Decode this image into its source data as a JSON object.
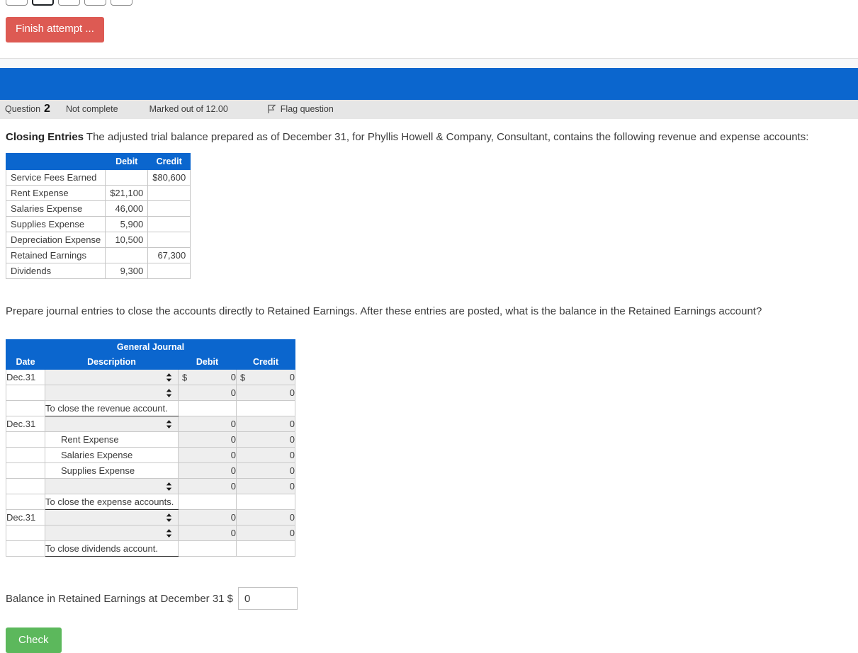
{
  "quiz_nav": {
    "boxes": [
      {
        "label": "",
        "current": false
      },
      {
        "label": "",
        "current": true
      },
      {
        "label": "",
        "current": false
      },
      {
        "label": "",
        "current": false
      },
      {
        "label": "",
        "current": false
      }
    ],
    "finish_attempt_label": "Finish attempt ..."
  },
  "colors": {
    "brand_blue": "#0b66ce",
    "danger_red": "#dd5a53",
    "success_green": "#5cb85c",
    "bar_grey": "#e6e6e6"
  },
  "question_header": {
    "question_label": "Question",
    "question_number": "2",
    "state": "Not complete",
    "marks": "Marked out of 12.00",
    "flag_label": "Flag question",
    "flag_icon": "flag-icon"
  },
  "prompt": {
    "bold_lead": "Closing Entries",
    "text": " The adjusted trial balance prepared as of December 31, for Phyllis Howell & Company, Consultant, contains the following revenue and expense accounts:",
    "second_paragraph": "Prepare journal entries to close the accounts directly to Retained Earnings. After these entries are posted, what is the balance in the Retained Earnings account?"
  },
  "trial_balance": {
    "headers": [
      "",
      "Debit",
      "Credit"
    ],
    "rows": [
      {
        "account": "Service Fees Earned",
        "debit": "",
        "credit": "$80,600"
      },
      {
        "account": "Rent Expense",
        "debit": "$21,100",
        "credit": ""
      },
      {
        "account": "Salaries Expense",
        "debit": "46,000",
        "credit": ""
      },
      {
        "account": "Supplies Expense",
        "debit": "5,900",
        "credit": ""
      },
      {
        "account": "Depreciation Expense",
        "debit": "10,500",
        "credit": ""
      },
      {
        "account": "Retained Earnings",
        "debit": "",
        "credit": "67,300"
      },
      {
        "account": "Dividends",
        "debit": "9,300",
        "credit": ""
      }
    ]
  },
  "general_journal": {
    "title": "General Journal",
    "headers": [
      "Date",
      "Description",
      "Debit",
      "Credit"
    ],
    "rows": [
      {
        "date": "Dec.31",
        "desc": "",
        "desc_type": "select",
        "debit": "0",
        "credit": "0",
        "debit_dollar": "$",
        "credit_dollar": "$",
        "amounts": "input"
      },
      {
        "date": "",
        "desc": "",
        "desc_type": "select",
        "debit": "0",
        "credit": "0",
        "debit_dollar": "",
        "credit_dollar": "",
        "amounts": "input"
      },
      {
        "date": "",
        "desc": "To close the revenue account.",
        "desc_type": "memo",
        "debit": "",
        "credit": "",
        "debit_dollar": "",
        "credit_dollar": "",
        "amounts": "empty"
      },
      {
        "date": "Dec.31",
        "desc": "",
        "desc_type": "select",
        "debit": "0",
        "credit": "0",
        "debit_dollar": "",
        "credit_dollar": "",
        "amounts": "input"
      },
      {
        "date": "",
        "desc": "Rent Expense",
        "desc_type": "label",
        "debit": "0",
        "credit": "0",
        "debit_dollar": "",
        "credit_dollar": "",
        "amounts": "input"
      },
      {
        "date": "",
        "desc": "Salaries Expense",
        "desc_type": "label",
        "debit": "0",
        "credit": "0",
        "debit_dollar": "",
        "credit_dollar": "",
        "amounts": "input"
      },
      {
        "date": "",
        "desc": "Supplies Expense",
        "desc_type": "label",
        "debit": "0",
        "credit": "0",
        "debit_dollar": "",
        "credit_dollar": "",
        "amounts": "input"
      },
      {
        "date": "",
        "desc": "",
        "desc_type": "select",
        "debit": "0",
        "credit": "0",
        "debit_dollar": "",
        "credit_dollar": "",
        "amounts": "input"
      },
      {
        "date": "",
        "desc": "To close the expense accounts.",
        "desc_type": "memo",
        "debit": "",
        "credit": "",
        "debit_dollar": "",
        "credit_dollar": "",
        "amounts": "empty"
      },
      {
        "date": "Dec.31",
        "desc": "",
        "desc_type": "select",
        "debit": "0",
        "credit": "0",
        "debit_dollar": "",
        "credit_dollar": "",
        "amounts": "input"
      },
      {
        "date": "",
        "desc": "",
        "desc_type": "select",
        "debit": "0",
        "credit": "0",
        "debit_dollar": "",
        "credit_dollar": "",
        "amounts": "input"
      },
      {
        "date": "",
        "desc": "To close dividends account.",
        "desc_type": "memo",
        "debit": "",
        "credit": "",
        "debit_dollar": "",
        "credit_dollar": "",
        "amounts": "empty"
      }
    ]
  },
  "balance_answer": {
    "label": "Balance in Retained Earnings at December 31 $",
    "value": "0"
  },
  "check_button": {
    "label": "Check"
  }
}
